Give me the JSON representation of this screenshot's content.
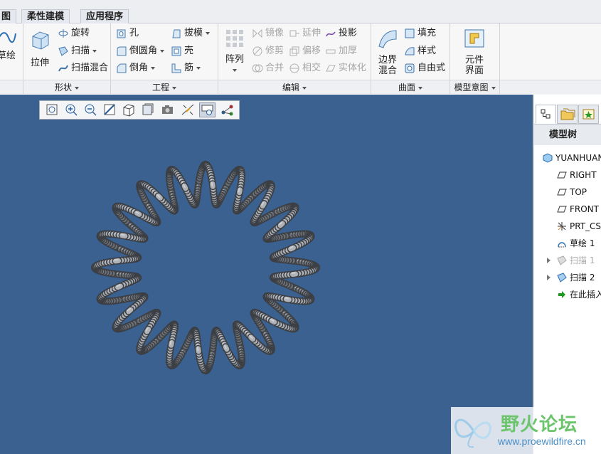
{
  "tabs": [
    {
      "label": "图"
    },
    {
      "label": "柔性建模"
    },
    {
      "label": "应用程序"
    }
  ],
  "groups": {
    "shape": {
      "label": "形状"
    },
    "engineering": {
      "label": "工程"
    },
    "edit": {
      "label": "编辑"
    },
    "surface": {
      "label": "曲面"
    },
    "model_intent": {
      "label": "模型意图"
    }
  },
  "buttons": {
    "sketch": "草绘",
    "extrude": "拉伸",
    "revolve": "旋转",
    "sweep": "扫描",
    "swept_blend": "扫描混合",
    "hole": "孔",
    "round": "倒圆角",
    "chamfer": "倒角",
    "draft": "拔模",
    "shell": "壳",
    "rib": "筋",
    "pattern": "阵列",
    "mirror": "镜像",
    "trim": "修剪",
    "merge": "合并",
    "extend": "延伸",
    "offset": "偏移",
    "intersect": "相交",
    "project": "投影",
    "thicken": "加厚",
    "solidify": "实体化",
    "boundary_blend_1": "边界",
    "boundary_blend_2": "混合",
    "fill": "填充",
    "style": "样式",
    "freestyle": "自由式",
    "component_interface_1": "元件",
    "component_interface_2": "界面"
  },
  "model_tree": {
    "header": "模型树",
    "nodes": [
      {
        "label": "YUANHUAN",
        "icon": "part-icon",
        "dim": false
      },
      {
        "label": "RIGHT",
        "icon": "datum-plane-icon",
        "dim": false
      },
      {
        "label": "TOP",
        "icon": "datum-plane-icon",
        "dim": false
      },
      {
        "label": "FRONT",
        "icon": "datum-plane-icon",
        "dim": false
      },
      {
        "label": "PRT_CSY",
        "icon": "coordinate-system-icon",
        "dim": false
      },
      {
        "label": "草绘 1",
        "icon": "sketch-icon",
        "dim": false
      },
      {
        "label": "扫描 1",
        "icon": "sweep-icon",
        "dim": true
      },
      {
        "label": "扫描 2",
        "icon": "sweep-icon",
        "dim": false
      },
      {
        "label": "在此插入",
        "icon": "insert-here-icon",
        "dim": false
      }
    ]
  },
  "watermark": {
    "title": "野火论坛",
    "url": "www.proewildfire.cn"
  },
  "colors": {
    "viewport": "#3a6190",
    "model": "#9a9da3",
    "watermark_green": "#6cc46c",
    "watermark_blue": "#4a8fc6"
  }
}
